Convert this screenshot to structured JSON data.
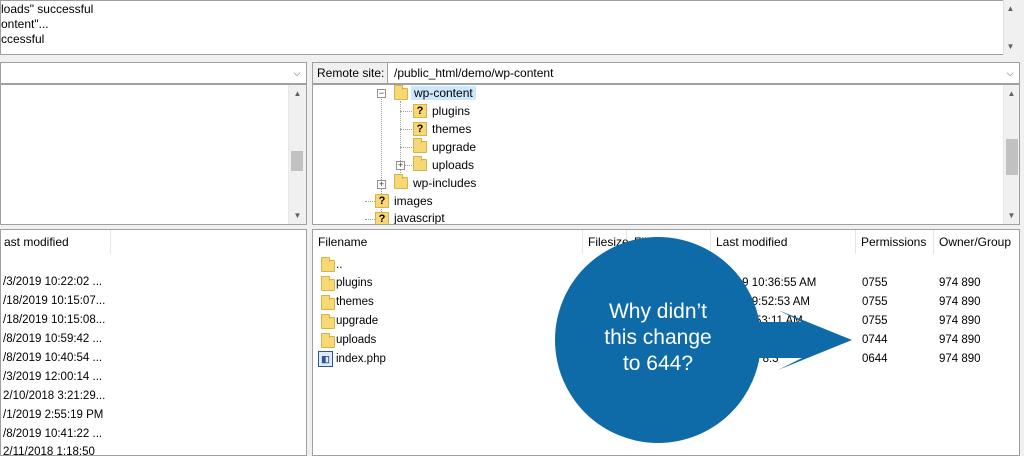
{
  "log": {
    "lines": [
      "loads\" successful",
      "ontent\"...",
      "ccessful"
    ]
  },
  "remote": {
    "label": "Remote site:",
    "path": "/public_html/demo/wp-content",
    "tree": {
      "wp_content": "wp-content",
      "plugins": "plugins",
      "themes": "themes",
      "upgrade": "upgrade",
      "uploads": "uploads",
      "wp_includes": "wp-includes",
      "images": "images",
      "javascript": "javascript"
    }
  },
  "local_list": {
    "header_last_modified": "ast modified",
    "rows": [
      "",
      "/3/2019 10:22:02 ...",
      "/18/2019 10:15:07...",
      "/18/2019 10:15:08...",
      "/8/2019 10:59:42 ...",
      "/8/2019 10:40:54 ...",
      "/3/2019 12:00:14 ...",
      "2/10/2018 3:21:29...",
      "/1/2019 2:55:19 PM",
      "/8/2019 10:41:22 ...",
      "2/11/2018 1:18:50"
    ]
  },
  "remote_list": {
    "headers": {
      "filename": "Filename",
      "filesize": "Filesize",
      "filetype": "Filetype",
      "last_modified": "Last modified",
      "permissions": "Permissions",
      "owner": "Owner/Group"
    },
    "rows": [
      {
        "name": "..",
        "modified": "",
        "perm": "",
        "owner": ""
      },
      {
        "name": "plugins",
        "modified": "2019 10:36:55 AM",
        "perm": "0755",
        "owner": "974 890"
      },
      {
        "name": "themes",
        "modified": "2019 9:52:53 AM",
        "perm": "0755",
        "owner": "974 890"
      },
      {
        "name": "upgrade",
        "modified": "19 10:53:11 AM",
        "perm": "0755",
        "owner": "974 890"
      },
      {
        "name": "uploads",
        "modified": "",
        "perm": "0744",
        "owner": "974 890"
      },
      {
        "name": "index.php",
        "modified": "2 8:3",
        "perm": "0644",
        "owner": "974 890"
      }
    ]
  },
  "callout": {
    "line1": "Why didn’t",
    "line2": "this change",
    "line3": "to 644?",
    "color": "#0e6ba8"
  }
}
